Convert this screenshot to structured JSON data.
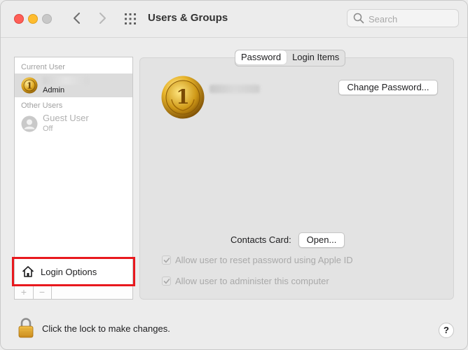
{
  "window": {
    "title": "Users & Groups",
    "search_placeholder": "Search"
  },
  "sidebar": {
    "current_user_header": "Current User",
    "other_users_header": "Other Users",
    "current_user": {
      "role": "Admin"
    },
    "guest_user": {
      "name": "Guest User",
      "status": "Off"
    },
    "login_options_label": "Login Options",
    "add_label": "+",
    "remove_label": "−"
  },
  "tabs": [
    {
      "label": "Password",
      "active": true
    },
    {
      "label": "Login Items",
      "active": false
    }
  ],
  "main": {
    "change_password_label": "Change Password...",
    "contacts_card_label": "Contacts Card:",
    "open_button_label": "Open...",
    "checkbox_reset_label": "Allow user to reset password using Apple ID",
    "checkbox_admin_label": "Allow user to administer this computer",
    "checkbox_reset_checked": true,
    "checkbox_admin_checked": true
  },
  "footer": {
    "lock_text": "Click the lock to make changes.",
    "help_label": "?"
  },
  "colors": {
    "highlight": "#e8191e",
    "close": "#fe5f57",
    "minimize": "#febc2e",
    "avatar_gold": "#d4a017"
  },
  "icons": [
    "back-chevron-icon",
    "forward-chevron-icon",
    "grid-icon",
    "search-icon",
    "medal-avatar-icon",
    "guest-avatar-icon",
    "home-icon",
    "checkmark-icon",
    "lock-icon"
  ]
}
